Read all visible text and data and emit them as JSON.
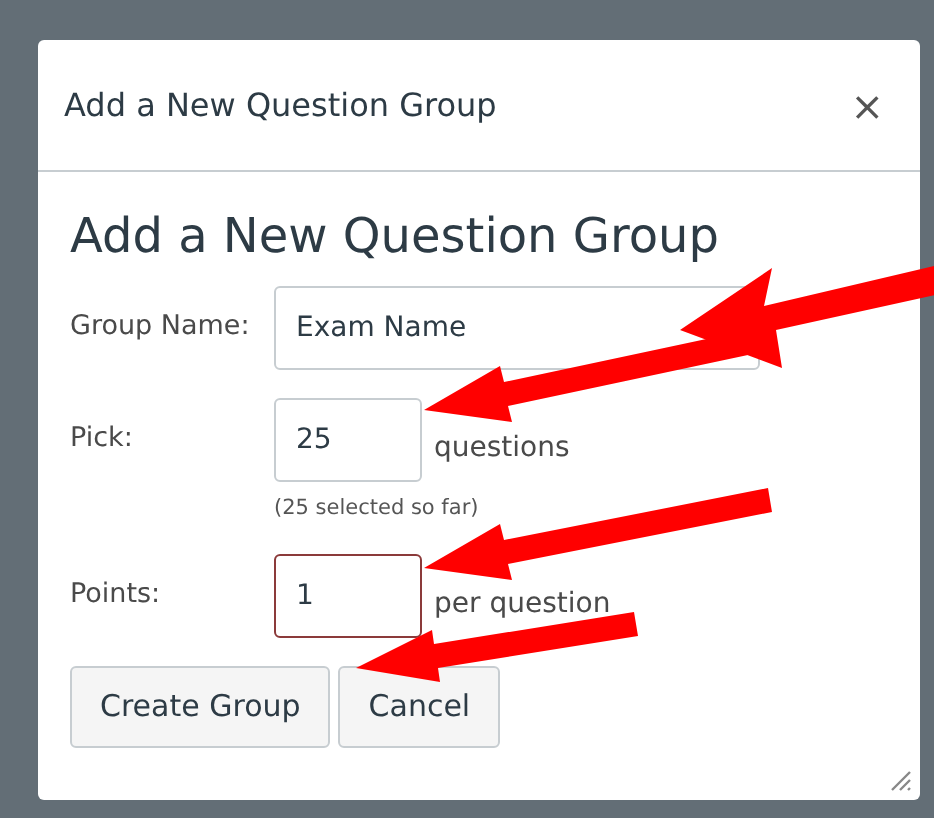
{
  "dialog": {
    "title": "Add a New Question Group",
    "close": "×",
    "heading": "Add a New Question Group",
    "fields": [
      {
        "label": "Group Name:",
        "value": "Exam Name",
        "wide": true,
        "highlighted": false
      },
      {
        "label": "Pick:",
        "value": "25",
        "suffix": "questions",
        "note": "(25 selected so far)",
        "wide": false,
        "highlighted": false
      },
      {
        "label": "Points:",
        "value": "1",
        "suffix": "per question",
        "wide": false,
        "highlighted": true
      }
    ],
    "buttons": [
      "Create Group",
      "Cancel"
    ]
  }
}
